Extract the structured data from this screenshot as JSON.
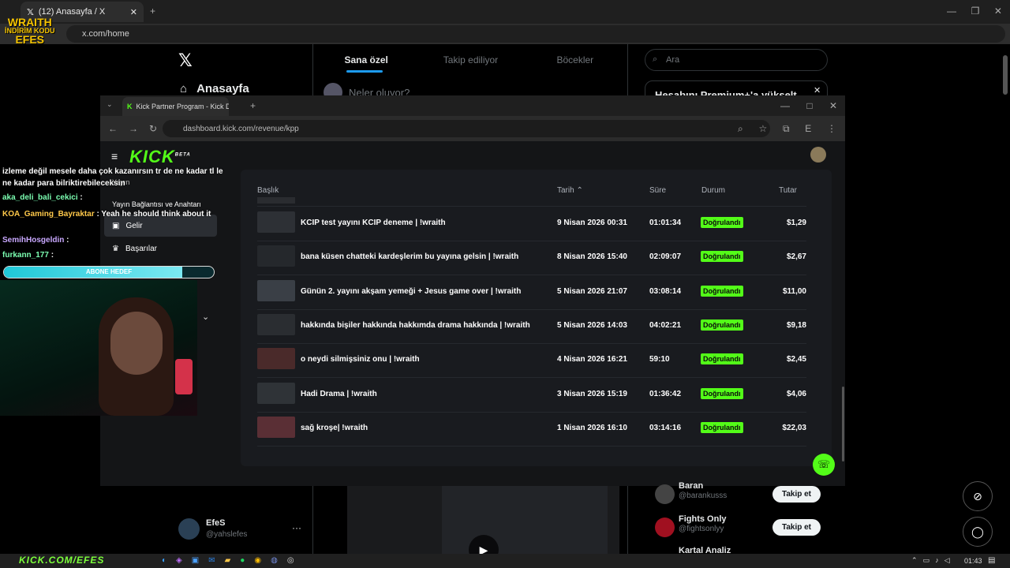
{
  "outer_browser": {
    "tab_title": "(12) Anasayfa / X",
    "url": "x.com/home"
  },
  "x_page": {
    "tabs": [
      "Sana özel",
      "Takip ediliyor",
      "Böcekler"
    ],
    "search_placeholder": "Ara",
    "premium_text": "Hesabını Premium+'a yükselt",
    "nav_home": "Anasayfa",
    "composer_placeholder": "Neler oluyor?",
    "profile_name": "EfeS",
    "profile_handle": "@yahslefes",
    "who_to_follow": [
      {
        "name": "Baran",
        "handle": "@barankusss",
        "button": "Takip et"
      },
      {
        "name": "Fights Only",
        "handle": "@fightsonlyy",
        "button": "Takip et"
      },
      {
        "name": "Kartal Analiz",
        "handle": "",
        "button": ""
      }
    ]
  },
  "inner_browser": {
    "tab_title": "Kick Partner Program - Kick Dash",
    "url": "dashboard.kick.com/revenue/kpp"
  },
  "kick": {
    "logo": "KICK",
    "logo_tag": "BETA",
    "sidebar": {
      "item_truncated": "Yayın",
      "section_label": "Yayın Bağlantısı ve Anahtarı",
      "items": [
        "Gelir",
        "Başarılar"
      ]
    },
    "table": {
      "headers": [
        "Başlık",
        "Tarih",
        "Süre",
        "Durum",
        "Tutar"
      ],
      "rows": [
        {
          "title": "KCIP test yayını KCIP deneme | !wraith",
          "date": "9 Nisan 2026 00:31",
          "duration": "01:01:34",
          "status": "Doğrulandı",
          "amount": "$1,29"
        },
        {
          "title": "bana küsen chatteki kardeşlerim bu yayına gelsin | !wraith",
          "date": "8 Nisan 2026 15:40",
          "duration": "02:09:07",
          "status": "Doğrulandı",
          "amount": "$2,67"
        },
        {
          "title": "Günün 2. yayını akşam yemeği + Jesus game over | !wraith",
          "date": "5 Nisan 2026 21:07",
          "duration": "03:08:14",
          "status": "Doğrulandı",
          "amount": "$11,00"
        },
        {
          "title": "hakkında bişiler hakkında hakkımda drama hakkında | !wraith",
          "date": "5 Nisan 2026 14:03",
          "duration": "04:02:21",
          "status": "Doğrulandı",
          "amount": "$9,18"
        },
        {
          "title": "o neydi silmişsiniz onu | !wraith",
          "date": "4 Nisan 2026 16:21",
          "duration": "59:10",
          "status": "Doğrulandı",
          "amount": "$2,45"
        },
        {
          "title": "Hadi Drama | !wraith",
          "date": "3 Nisan 2026 15:19",
          "duration": "01:36:42",
          "status": "Doğrulandı",
          "amount": "$4,06"
        },
        {
          "title": "sağ kroşe| !wraith",
          "date": "1 Nisan 2026 16:10",
          "duration": "03:14:16",
          "status": "Doğrulandı",
          "amount": "$22,03"
        }
      ]
    },
    "accent_color": "#53fc18"
  },
  "stream_overlay": {
    "brand_top": "WRAITH",
    "brand_sub": "İNDİRİM KODU",
    "brand_code": "EFES",
    "brand_bottom": "KICK.COM/EFES",
    "chat": [
      {
        "user": "",
        "text": "izleme değil mesele daha çok kazanırsın tr de ne kadar tl le ne kadar para bilriktirebileceksin"
      },
      {
        "user": "aka_deli_bali_cekici",
        "text": ":"
      },
      {
        "user": "KOA_Gaming_Bayraktar",
        "text": ": Yeah he should think about it"
      },
      {
        "user": "SemihHosgeldin",
        "text": ":"
      },
      {
        "user": "furkann_177",
        "text": ":"
      }
    ],
    "goal_label": "ABONE HEDEF",
    "goal_progress": 0.85
  },
  "taskbar": {
    "time": "01:43"
  }
}
